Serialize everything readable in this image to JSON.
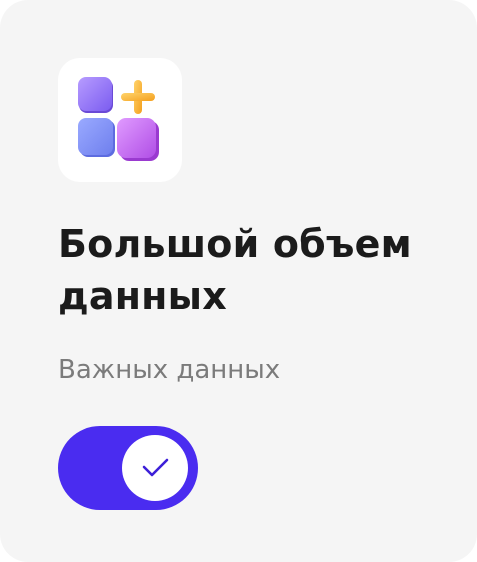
{
  "card": {
    "title": "Большой объем данных",
    "subtitle": "Важных данных",
    "icon": "apps-add-icon"
  },
  "toggle": {
    "state": "on",
    "checked": true,
    "knob_icon": "check-icon"
  },
  "colors": {
    "card_background": "#f5f5f5",
    "icon_tile_background": "#ffffff",
    "toggle_on": "#4a2cf0",
    "check": "#3d1fd8",
    "title": "#1b1b1b",
    "subtitle": "#7b7b7b"
  }
}
